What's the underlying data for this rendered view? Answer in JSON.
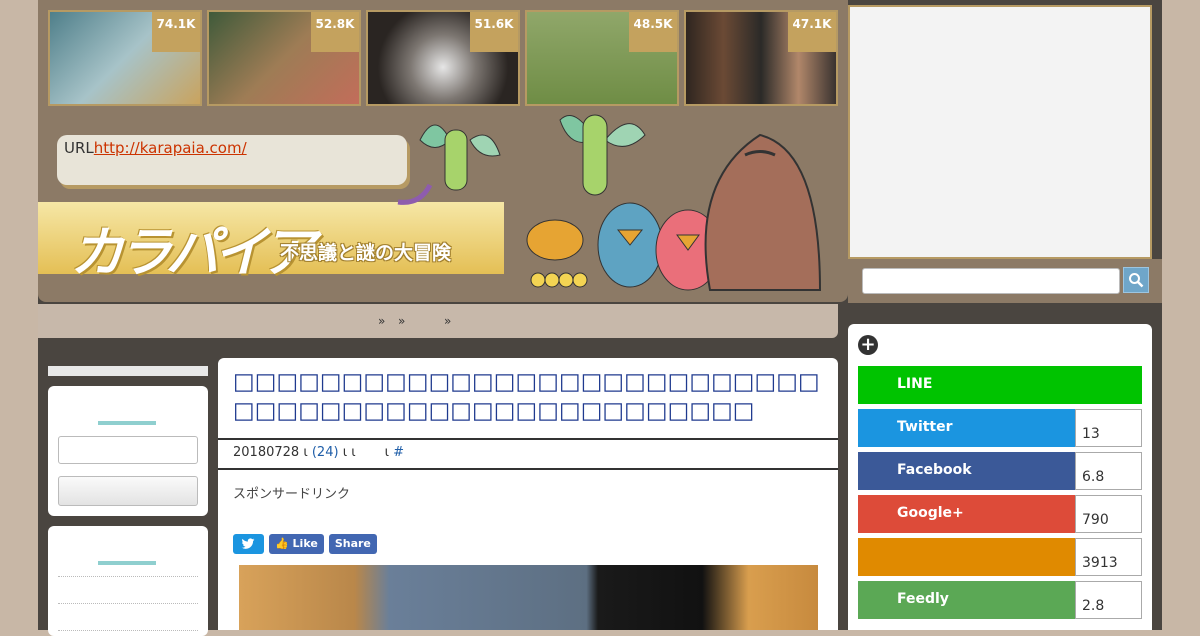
{
  "thumbnails": [
    {
      "count": "74.1K",
      "color": "#7ba5b3"
    },
    {
      "count": "52.8K",
      "color": "#6f6a4e"
    },
    {
      "count": "51.6K",
      "color": "#5b544e"
    },
    {
      "count": "48.5K",
      "color": "#8fa458"
    },
    {
      "count": "47.1K",
      "color": "#6e4a35"
    }
  ],
  "header": {
    "url_label": "URL",
    "url_link": "http://karapaia.com/",
    "logo": "カラパイア",
    "tagline": "不思議と謎の大冒険"
  },
  "breadcrumb": {
    "sep1": "»",
    "sep2": "»",
    "sep3": "»"
  },
  "article": {
    "title": "□□□□□□□□□□□□□□□□□□□□□□□□□□□□□□□□□□□□□□□□□□□□□□□□□□□",
    "date": "20180728",
    "sep1": "ι",
    "comments": "(24)",
    "sep2": "ι ι",
    "sep3": "ι",
    "tag": "#",
    "sponsor": "スポンサードリンク",
    "share_tweet": "",
    "share_like": "Like",
    "share_share": "Share"
  },
  "social": {
    "buttons": [
      {
        "label": "LINE",
        "count": "",
        "color": "#00c300"
      },
      {
        "label": "Twitter",
        "count": "13",
        "color": "#1b95e0"
      },
      {
        "label": "Facebook",
        "count": "6.8",
        "color": "#3b5998"
      },
      {
        "label": "Google+",
        "count": "790",
        "color": "#dd4b39"
      },
      {
        "label": "",
        "count": "3913",
        "color": "#e08a00"
      },
      {
        "label": "Feedly",
        "count": "2.8",
        "color": "#5ba855"
      }
    ]
  }
}
